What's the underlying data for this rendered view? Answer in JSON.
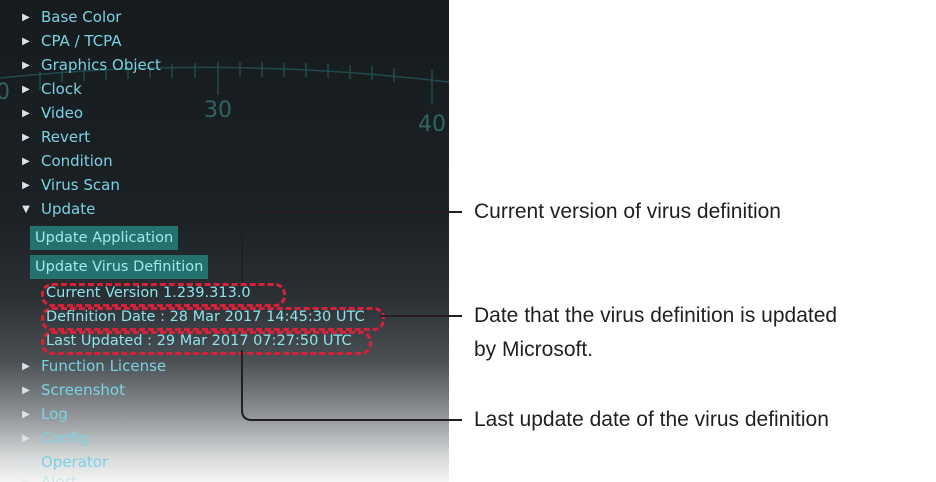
{
  "background_numbers": [
    "30",
    "40",
    "0"
  ],
  "menu_top": [
    {
      "label": "Base Color",
      "arrow": "▶"
    },
    {
      "label": "CPA / TCPA",
      "arrow": "▶"
    },
    {
      "label": "Graphics Object",
      "arrow": "▶"
    },
    {
      "label": "Clock",
      "arrow": "▶"
    },
    {
      "label": "Video",
      "arrow": "▶"
    },
    {
      "label": "Revert",
      "arrow": "▶"
    },
    {
      "label": "Condition",
      "arrow": "▶"
    },
    {
      "label": "Virus Scan",
      "arrow": "▶"
    },
    {
      "label": "Update",
      "arrow": "▼"
    }
  ],
  "update_section": {
    "update_application_button": "Update Application",
    "update_virus_definition_button": "Update Virus Definition",
    "current_version": "Current Version 1.239.313.0",
    "definition_date": "Definition Date : 28 Mar 2017 14:45:30 UTC",
    "last_updated": "Last Updated : 29 Mar 2017 07:27:50 UTC"
  },
  "menu_bottom": [
    {
      "label": "Function License",
      "arrow": "▶"
    },
    {
      "label": "Screenshot",
      "arrow": "▶"
    },
    {
      "label": "Log",
      "arrow": "▶"
    },
    {
      "label": "Config",
      "arrow": "▶"
    },
    {
      "label": "Operator",
      "arrow": "▶"
    },
    {
      "label": "Alert",
      "arrow": "▶"
    }
  ],
  "callouts": {
    "current_version": "Current version of virus definition",
    "definition_date_line1": "Date that the virus definition is updated",
    "definition_date_line2": "by Microsoft.",
    "last_update": "Last update date of the virus definition"
  },
  "colors": {
    "menu_text": "#7cd2e4",
    "button_bg": "#24726d",
    "highlight_oval": "#d6213a",
    "callout_line": "#231f20"
  }
}
